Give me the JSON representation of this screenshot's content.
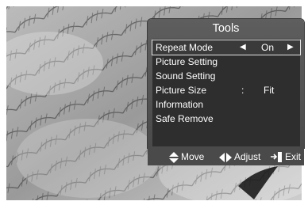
{
  "tools": {
    "title": "Tools",
    "items": [
      {
        "label": "Repeat Mode",
        "value": "On"
      },
      {
        "label": "Picture Setting"
      },
      {
        "label": "Sound Setting"
      },
      {
        "label": "Picture Size",
        "separator": ":",
        "value": "Fit"
      },
      {
        "label": "Information"
      },
      {
        "label": "Safe Remove"
      }
    ]
  },
  "footer": {
    "move_label": "Move",
    "adjust_label": "Adjust",
    "exit_label": "Exit"
  },
  "icons": {
    "left_arrow": "arrow-left-icon",
    "right_arrow": "arrow-right-icon",
    "move": "up-down-arrows-icon",
    "adjust": "left-right-arrows-icon",
    "exit": "exit-icon"
  }
}
